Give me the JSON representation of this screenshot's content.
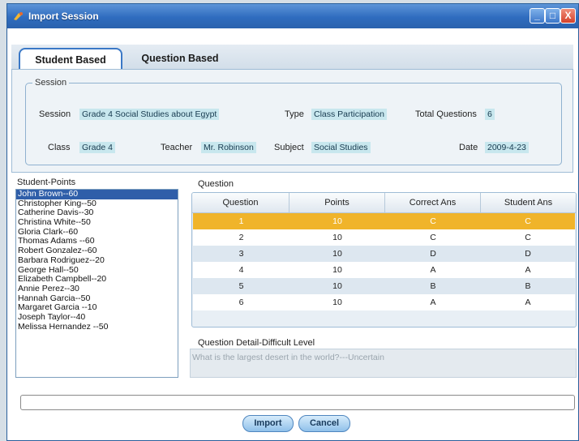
{
  "window": {
    "title": "Import Session",
    "min_glyph": "_",
    "max_glyph": "□",
    "close_glyph": "X"
  },
  "tabs": [
    {
      "label": "Student Based",
      "active": true
    },
    {
      "label": "Question Based",
      "active": false
    }
  ],
  "session": {
    "legend": "Session",
    "session_label": "Session",
    "session_value": "Grade 4 Social Studies about Egypt",
    "type_label": "Type",
    "type_value": "Class Participation",
    "total_label": "Total Questions",
    "total_value": "6",
    "class_label": "Class",
    "class_value": "Grade 4",
    "teacher_label": "Teacher",
    "teacher_value": "Mr. Robinson",
    "subject_label": "Subject",
    "subject_value": "Social Studies",
    "date_label": "Date",
    "date_value": "2009-4-23"
  },
  "student_points": {
    "title": "Student-Points",
    "items": [
      "John Brown--60",
      "Christopher  King--50",
      "Catherine Davis--30",
      "Christina White--50",
      "Gloria Clark--60",
      "Thomas Adams --60",
      "Robert Gonzalez--60",
      "Barbara Rodriguez--20",
      "George Hall--50",
      "Elizabeth Campbell--20",
      "Annie Perez--30",
      "Hannah Garcia--50",
      "Margaret Garcia  --10",
      "Joseph Taylor--40",
      "Melissa Hernandez  --50"
    ],
    "selected_index": 0
  },
  "question": {
    "title": "Question",
    "columns": [
      "Question",
      "Points",
      "Correct Ans",
      "Student Ans"
    ],
    "rows": [
      [
        "1",
        "10",
        "C",
        "C"
      ],
      [
        "2",
        "10",
        "C",
        "C"
      ],
      [
        "3",
        "10",
        "D",
        "D"
      ],
      [
        "4",
        "10",
        "A",
        "A"
      ],
      [
        "5",
        "10",
        "B",
        "B"
      ],
      [
        "6",
        "10",
        "A",
        "A"
      ]
    ],
    "selected_index": 0
  },
  "detail": {
    "title": "Question Detail-Difficult Level",
    "text": "What is the largest desert in the world?---Uncertain"
  },
  "buttons": {
    "import": "Import",
    "cancel": "Cancel"
  },
  "colors": {
    "title_bar": "#2f6cbf",
    "selected_row": "#f0b42a",
    "selected_list_item": "#2f5ea9",
    "value_highlight": "#c8e7ee"
  }
}
